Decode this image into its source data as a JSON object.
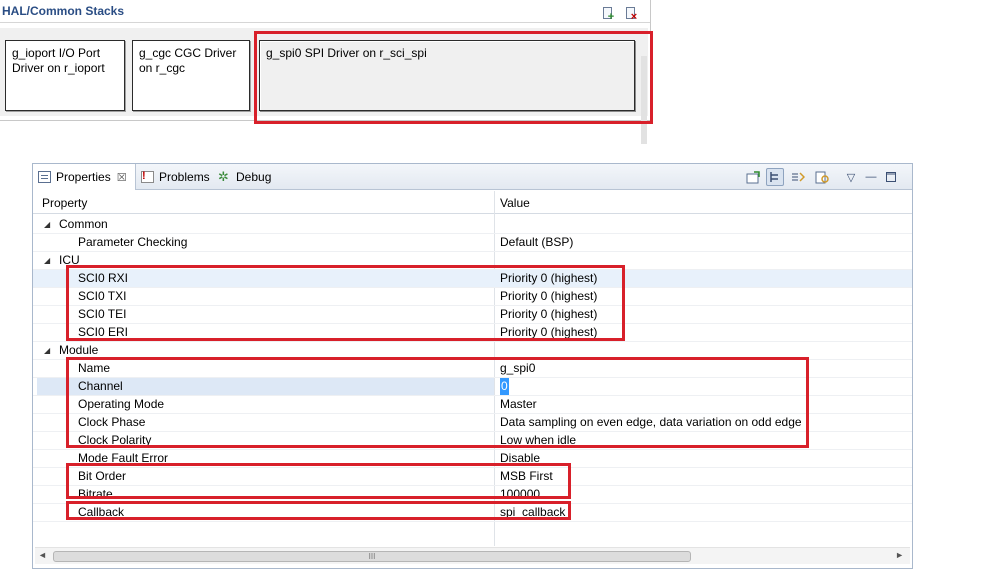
{
  "hal_panel": {
    "title": "HAL/Common Stacks",
    "add_icon": "add-stack-icon",
    "remove_icon": "remove-stack-icon",
    "blocks": [
      {
        "label": "g_ioport I/O Port Driver on r_ioport"
      },
      {
        "label": "g_cgc CGC Driver on r_cgc"
      },
      {
        "label": "g_spi0 SPI Driver on r_sci_spi"
      }
    ]
  },
  "view": {
    "tabs": [
      {
        "label": "Properties",
        "icon": "properties-icon",
        "close": "☒"
      },
      {
        "label": "Problems",
        "icon": "problems-icon"
      },
      {
        "label": "Debug",
        "icon": "debug-icon"
      }
    ],
    "toolbar_icons": [
      "new-pin-icon",
      "show-categories-icon",
      "show-advanced-icon",
      "filter-icon",
      "view-menu-icon",
      "minimize-icon",
      "maximize-icon"
    ]
  },
  "table": {
    "columns": {
      "property": "Property",
      "value": "Value"
    },
    "rows": [
      {
        "kind": "cat",
        "name": "Common",
        "value": ""
      },
      {
        "kind": "prop",
        "name": "Parameter Checking",
        "value": "Default (BSP)"
      },
      {
        "kind": "cat",
        "name": "ICU",
        "value": ""
      },
      {
        "kind": "prop",
        "name": "SCI0 RXI",
        "value": "Priority 0 (highest)"
      },
      {
        "kind": "prop",
        "name": "SCI0 TXI",
        "value": "Priority 0 (highest)"
      },
      {
        "kind": "prop",
        "name": "SCI0 TEI",
        "value": "Priority 0 (highest)"
      },
      {
        "kind": "prop",
        "name": "SCI0 ERI",
        "value": "Priority 0 (highest)"
      },
      {
        "kind": "cat",
        "name": "Module",
        "value": ""
      },
      {
        "kind": "prop",
        "name": "Name",
        "value": "g_spi0"
      },
      {
        "kind": "prop",
        "name": "Channel",
        "value": "0"
      },
      {
        "kind": "prop",
        "name": "Operating Mode",
        "value": "Master"
      },
      {
        "kind": "prop",
        "name": "Clock Phase",
        "value": "Data sampling on even edge, data variation on odd edge"
      },
      {
        "kind": "prop",
        "name": "Clock Polarity",
        "value": "Low when idle"
      },
      {
        "kind": "prop",
        "name": "Mode Fault Error",
        "value": "Disable"
      },
      {
        "kind": "prop",
        "name": "Bit Order",
        "value": "MSB First"
      },
      {
        "kind": "prop",
        "name": "Bitrate",
        "value": "100000"
      },
      {
        "kind": "prop",
        "name": "Callback",
        "value": "spi_callback"
      }
    ]
  },
  "scrollbar": {
    "thumb_grip": "III"
  },
  "colors": {
    "highlight": "#d8202a",
    "selection": "#3399ff",
    "title": "#2a4d84"
  }
}
